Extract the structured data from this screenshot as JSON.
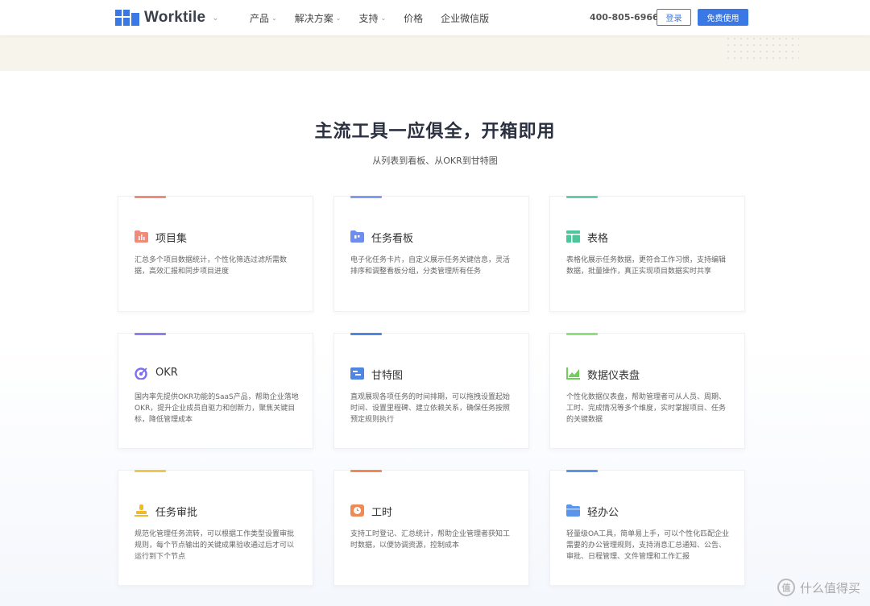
{
  "header": {
    "brand": "Worktile",
    "nav": [
      {
        "label": "产品",
        "dropdown": true
      },
      {
        "label": "解决方案",
        "dropdown": true
      },
      {
        "label": "支持",
        "dropdown": true
      },
      {
        "label": "价格",
        "dropdown": false
      },
      {
        "label": "企业微信版",
        "dropdown": false
      }
    ],
    "phone": "400-805-6966",
    "login_label": "登录",
    "free_label": "免费使用"
  },
  "section": {
    "title": "主流工具一应俱全，开箱即用",
    "subtitle": "从列表到看板、从OKR到甘特图"
  },
  "cards": [
    {
      "title": "项目集",
      "desc": "汇总多个项目数据统计，个性化筛选过滤所需数据，高效汇报和同步项目进度",
      "accent": "#f08a7a",
      "icon": "folder-chart-icon"
    },
    {
      "title": "任务看板",
      "desc": "电子化任务卡片，自定义展示任务关键信息，灵活排序和调整看板分组，分类管理所有任务",
      "accent": "#7d9cf2",
      "icon": "kanban-folder-icon"
    },
    {
      "title": "表格",
      "desc": "表格化展示任务数据，更符合工作习惯，支持编辑数据，批量操作，真正实现项目数据实时共享",
      "accent": "#5fd0a8",
      "icon": "table-icon"
    },
    {
      "title": "OKR",
      "desc": "国内率先提供OKR功能的SaaS产品，帮助企业落地OKR，提升企业成员自驱力和创新力，聚焦关键目标，降低管理成本",
      "accent": "#8c7ff0",
      "icon": "target-icon"
    },
    {
      "title": "甘特图",
      "desc": "直观展现各项任务的时间排期，可以拖拽设置起始时间、设置里程碑、建立依赖关系，确保任务按照预定规则执行",
      "accent": "#4e86e0",
      "icon": "gantt-icon"
    },
    {
      "title": "数据仪表盘",
      "desc": "个性化数据仪表盘，帮助管理者可从人员、周期、工时、完成情况等多个维度，实时掌握项目、任务的关键数据",
      "accent": "#8ee07a",
      "icon": "chart-icon"
    },
    {
      "title": "任务审批",
      "desc": "规范化管理任务流转，可以根据工作类型设置审批规则，每个节点输出的关键成果验收通过后才可以运行到下个节点",
      "accent": "#f3c64a",
      "icon": "stamp-icon"
    },
    {
      "title": "工时",
      "desc": "支持工时登记、汇总统计，帮助企业管理者获知工时数据，以便协调资源，控制成本",
      "accent": "#f08a55",
      "icon": "clock-icon"
    },
    {
      "title": "轻办公",
      "desc": "轻量级OA工具，简单易上手，可以个性化匹配企业需要的办公管理规则，支持消息汇总通知、公告、审批、日程管理、文件管理和工作汇报",
      "accent": "#5b95ea",
      "icon": "folder-icon"
    }
  ],
  "watermark": {
    "glyph": "值",
    "text": "什么值得买"
  }
}
